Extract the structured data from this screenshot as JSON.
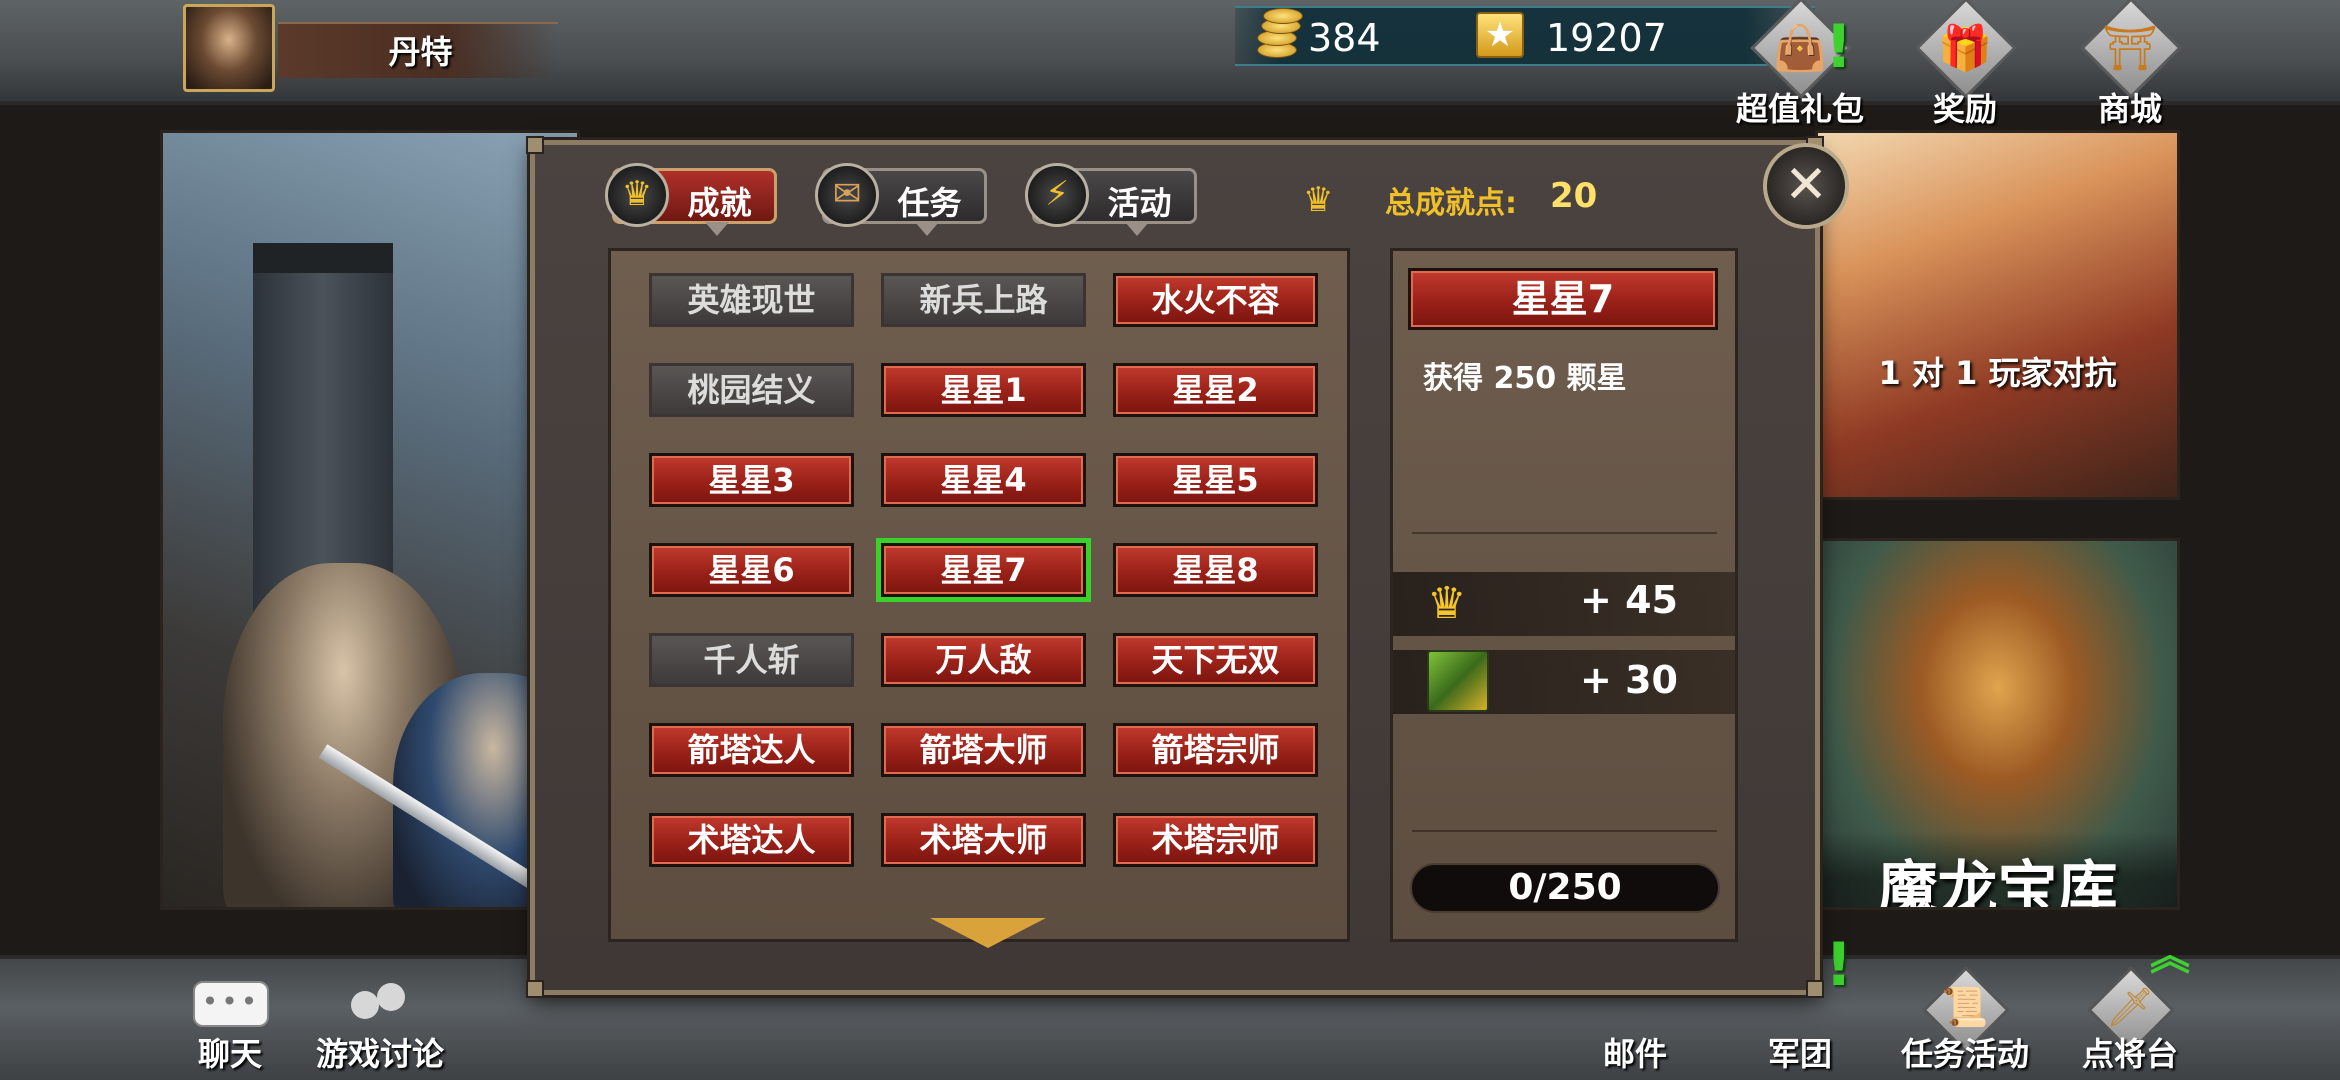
{
  "player": {
    "name": "丹特"
  },
  "currency": {
    "gold": "384",
    "stars": "19207"
  },
  "top_menu": [
    {
      "label": "超值礼包",
      "icon": "gift-bag-icon",
      "alert": true
    },
    {
      "label": "奖励",
      "icon": "gift-box-icon",
      "alert": false
    },
    {
      "label": "商城",
      "icon": "pagoda-icon",
      "alert": false
    }
  ],
  "bottom_menu": [
    {
      "label": "聊天",
      "icon": "chat-icon"
    },
    {
      "label": "游戏讨论",
      "icon": "discussion-icon"
    },
    {
      "label": "邮件",
      "icon": "mail-icon"
    },
    {
      "label": "军团",
      "icon": "legion-icon",
      "alert": true
    },
    {
      "label": "任务活动",
      "icon": "scroll-icon"
    },
    {
      "label": "点将台",
      "icon": "sword-icon",
      "upgrade": true
    }
  ],
  "background_cards": {
    "pvp_label": "1 对 1 玩家对抗",
    "dragon_label": "魔龙宝库"
  },
  "dialog": {
    "tabs": [
      {
        "label": "成就",
        "icon": "crown-icon",
        "active": true
      },
      {
        "label": "任务",
        "icon": "scroll-icon",
        "active": false
      },
      {
        "label": "活动",
        "icon": "lightning-icon",
        "active": false
      }
    ],
    "total_label": "总成就点:",
    "total_value": "20",
    "achievements": [
      [
        "英雄现世",
        "新兵上路",
        "水火不容"
      ],
      [
        "桃园结义",
        "星星1",
        "星星2"
      ],
      [
        "星星3",
        "星星4",
        "星星5"
      ],
      [
        "星星6",
        "星星7",
        "星星8"
      ],
      [
        "千人斩",
        "万人敌",
        "天下无双"
      ],
      [
        "箭塔达人",
        "箭塔大师",
        "箭塔宗师"
      ],
      [
        "术塔达人",
        "术塔大师",
        "术塔宗师"
      ]
    ],
    "selected": "星星7",
    "detail": {
      "title": "星星7",
      "description": "获得 250 颗星",
      "rewards": [
        {
          "icon": "crown-icon",
          "value": "+ 45"
        },
        {
          "icon": "gem-icon",
          "value": "+ 30"
        }
      ],
      "progress": "0/250"
    }
  },
  "colors": {
    "accent_red": "#9a2118",
    "selection_green": "#3ad12a",
    "gold_text": "#f0c02a"
  }
}
